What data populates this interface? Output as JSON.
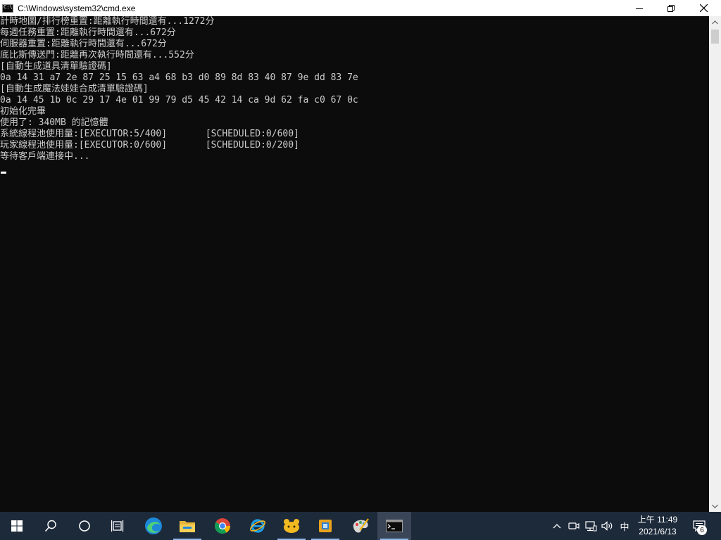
{
  "window": {
    "title": "C:\\Windows\\system32\\cmd.exe",
    "icon_prompt": "C:\\"
  },
  "console": {
    "lines": [
      "計時地圖/排行榜重置:距離執行時間還有...1272分",
      "每週任務重置:距離執行時間還有...672分",
      "伺服器重置:距離執行時間還有...672分",
      "底比斯傳送門:距離再次執行時間還有...552分",
      "[自動生成道具清單驗證碼]",
      "0a 14 31 a7 2e 87 25 15 63 a4 68 b3 d0 89 8d 83 40 87 9e dd 83 7e",
      "[自動生成魔法娃娃合成清單驗證碼]",
      "0a 14 45 1b 0c 29 17 4e 01 99 79 d5 45 42 14 ca 9d 62 fa c0 67 0c",
      "初始化完畢",
      "使用了: 340MB 的記憶體",
      "系統線程池使用量:[EXECUTOR:5/400]       [SCHEDULED:0/600]",
      "玩家線程池使用量:[EXECUTOR:0/600]       [SCHEDULED:0/200]",
      "等待客戶端連接中..."
    ]
  },
  "taskbar": {
    "items": [
      "windows-start",
      "search",
      "cortana",
      "task-view",
      "edge",
      "file-explorer",
      "chrome",
      "internet-explorer",
      "app-yellow",
      "app-box",
      "paint",
      "cmd"
    ],
    "tray": {
      "ime": "中",
      "time": "上午 11:49",
      "date": "2021/6/13",
      "notifications": "6"
    }
  },
  "colors": {
    "console_bg": "#0c0c0c",
    "console_text": "#cccccc",
    "taskbar_bg": "#1d2a3a"
  }
}
